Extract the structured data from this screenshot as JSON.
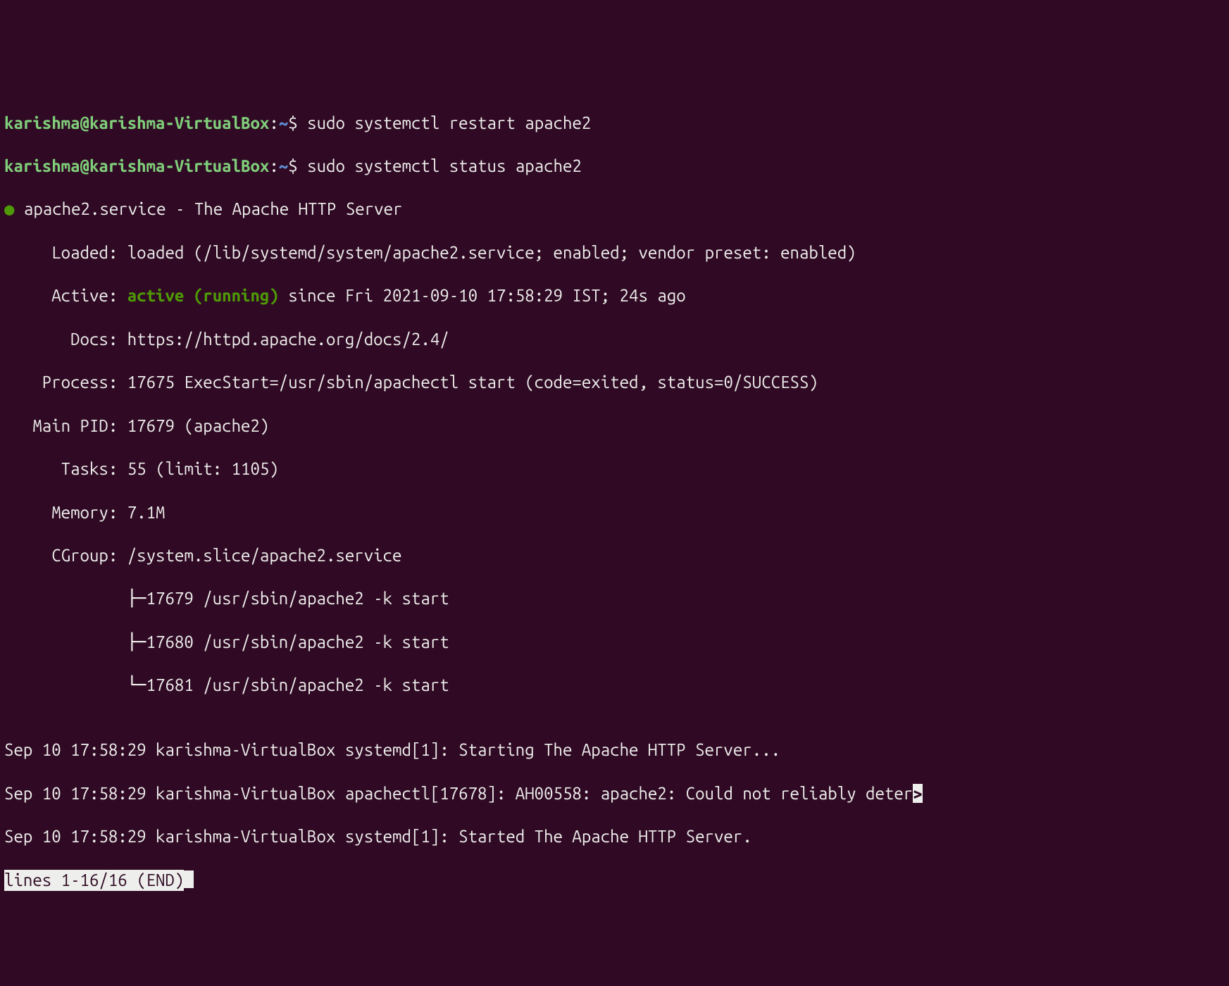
{
  "prompt": {
    "user": "karishma@karishma-VirtualBox",
    "sep": ":",
    "path": "~",
    "sign": "$"
  },
  "cmd1": "sudo systemctl restart apache2",
  "cmd2": "sudo systemctl status apache2",
  "bullet": "●",
  "service_line": "apache2.service - The Apache HTTP Server",
  "loaded": {
    "label": "     Loaded: ",
    "value": "loaded (/lib/systemd/system/apache2.service; enabled; vendor preset: enabled)"
  },
  "active": {
    "label": "     Active: ",
    "state": "active (running)",
    "rest": " since Fri 2021-09-10 17:58:29 IST; 24s ago"
  },
  "docs": {
    "label": "       Docs: ",
    "value": "https://httpd.apache.org/docs/2.4/"
  },
  "process": {
    "label": "    Process: ",
    "value": "17675 ExecStart=/usr/sbin/apachectl start (code=exited, status=0/SUCCESS)"
  },
  "mainpid": {
    "label": "   Main PID: ",
    "value": "17679 (apache2)"
  },
  "tasks": {
    "label": "      Tasks: ",
    "value": "55 (limit: 1105)"
  },
  "memory": {
    "label": "     Memory: ",
    "value": "7.1M"
  },
  "cgroup": {
    "label": "     CGroup: ",
    "value": "/system.slice/apache2.service"
  },
  "tree1": "             ├─17679 /usr/sbin/apache2 -k start",
  "tree2": "             ├─17680 /usr/sbin/apache2 -k start",
  "tree3": "             └─17681 /usr/sbin/apache2 -k start",
  "blank": "",
  "log1": "Sep 10 17:58:29 karishma-VirtualBox systemd[1]: Starting The Apache HTTP Server...",
  "log2": "Sep 10 17:58:29 karishma-VirtualBox apachectl[17678]: AH00558: apache2: Could not reliably deter",
  "log2_cont": ">",
  "log3": "Sep 10 17:58:29 karishma-VirtualBox systemd[1]: Started The Apache HTTP Server.",
  "statusbar": "lines 1-16/16 (END)"
}
